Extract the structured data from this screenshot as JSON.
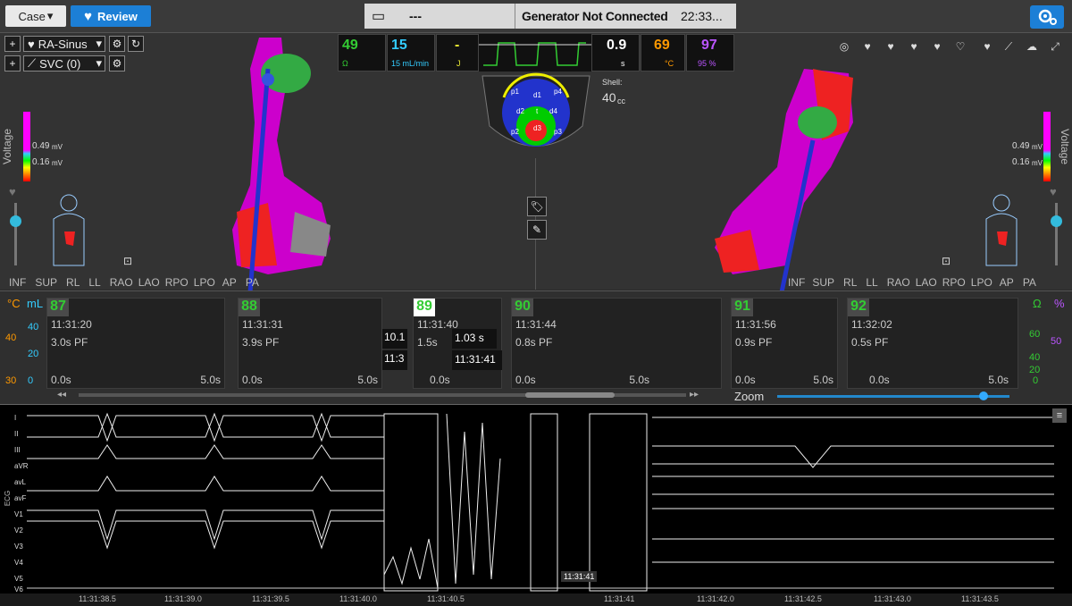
{
  "topbar": {
    "case_label": "Case",
    "case_arrow": "▾",
    "review_label": "Review",
    "status_dash": "---",
    "status_generator": "Generator Not Connected",
    "status_time": "22:33..."
  },
  "map_controls": {
    "rhythm": "RA-Sinus",
    "catheter": "SVC (0)",
    "plus": "+"
  },
  "vitals": [
    {
      "value": "49",
      "unit": "Ω",
      "color": "#3c3"
    },
    {
      "value": "15",
      "unit": "15 mL/min",
      "color": "#3cf"
    },
    {
      "value": "-",
      "unit": "J",
      "color": "#ee3"
    },
    {
      "value": "0.9",
      "unit": "s",
      "color": "#fff"
    },
    {
      "value": "69",
      "unit": "°C",
      "color": "#f90"
    },
    {
      "value": "97",
      "unit": "95 %",
      "color": "#b5f"
    }
  ],
  "shell": {
    "label": "Shell:",
    "value": "40",
    "unit": "cc"
  },
  "electrodes": [
    "p1",
    "d1",
    "p4",
    "d2",
    "t",
    "d4",
    "p2",
    "d3",
    "p3"
  ],
  "voltage": {
    "label": "Voltage",
    "high": "0.49",
    "low": "0.16",
    "unit": "mV"
  },
  "views_left": [
    "INF",
    "SUP",
    "RL",
    "LL",
    "RAO",
    "LAO",
    "RPO",
    "LPO",
    "AP",
    "PA"
  ],
  "views_right": [
    "INF",
    "SUP",
    "RL",
    "LL",
    "RAO",
    "LAO",
    "RPO",
    "LPO",
    "AP",
    "PA"
  ],
  "strip": {
    "left_axis": {
      "temp_unit": "°C",
      "vol_unit": "mL",
      "t40": "40",
      "t30": "30",
      "v40": "40",
      "v20": "20",
      "v0": "0"
    },
    "right_axis": {
      "ohm": "Ω",
      "pct": "%",
      "r60": "60",
      "r40": "40",
      "r20": "20",
      "r0": "0",
      "p50": "50"
    },
    "segments": [
      {
        "num": "87",
        "time": "11:31:20",
        "pf": "3.0s PF",
        "zero": "0.0s",
        "five": "5.0s"
      },
      {
        "num": "88",
        "time": "11:31:31",
        "pf": "3.9s PF",
        "zero": "0.0s",
        "five": "5.0s"
      },
      {
        "num": "89",
        "time": "11:31:40",
        "pf": "1.5s",
        "zero": "0.0s",
        "five": ""
      },
      {
        "num": "90",
        "time": "11:31:44",
        "pf": "0.8s PF",
        "zero": "0.0s",
        "five": "5.0s"
      },
      {
        "num": "91",
        "time": "11:31:56",
        "pf": "0.9s PF",
        "zero": "0.0s",
        "five": "5.0s"
      },
      {
        "num": "92",
        "time": "11:32:02",
        "pf": "0.5s PF",
        "zero": "0.0s",
        "five": "5.0s"
      }
    ],
    "tooltip_a": "10.1",
    "tooltip_b": "11:3",
    "tooltip_dur": "1.03 s",
    "tooltip_time": "11:31:41",
    "zoom": "Zoom"
  },
  "ecg": {
    "leads": [
      "I",
      "II",
      "III",
      "aVR",
      "avL",
      "avF",
      "V1",
      "V2",
      "V3",
      "V4",
      "V5",
      "V6"
    ],
    "axis_label": "ECG",
    "cursor_time": "11:31:41",
    "ticks": [
      "11:31:38.5",
      "11:31:39.0",
      "11:31:39.5",
      "11:31:40.0",
      "11:31:40.5",
      "11:31:41",
      "11:31:42.0",
      "11:31:42.5",
      "11:31:43.0",
      "11:31:43.5"
    ]
  }
}
